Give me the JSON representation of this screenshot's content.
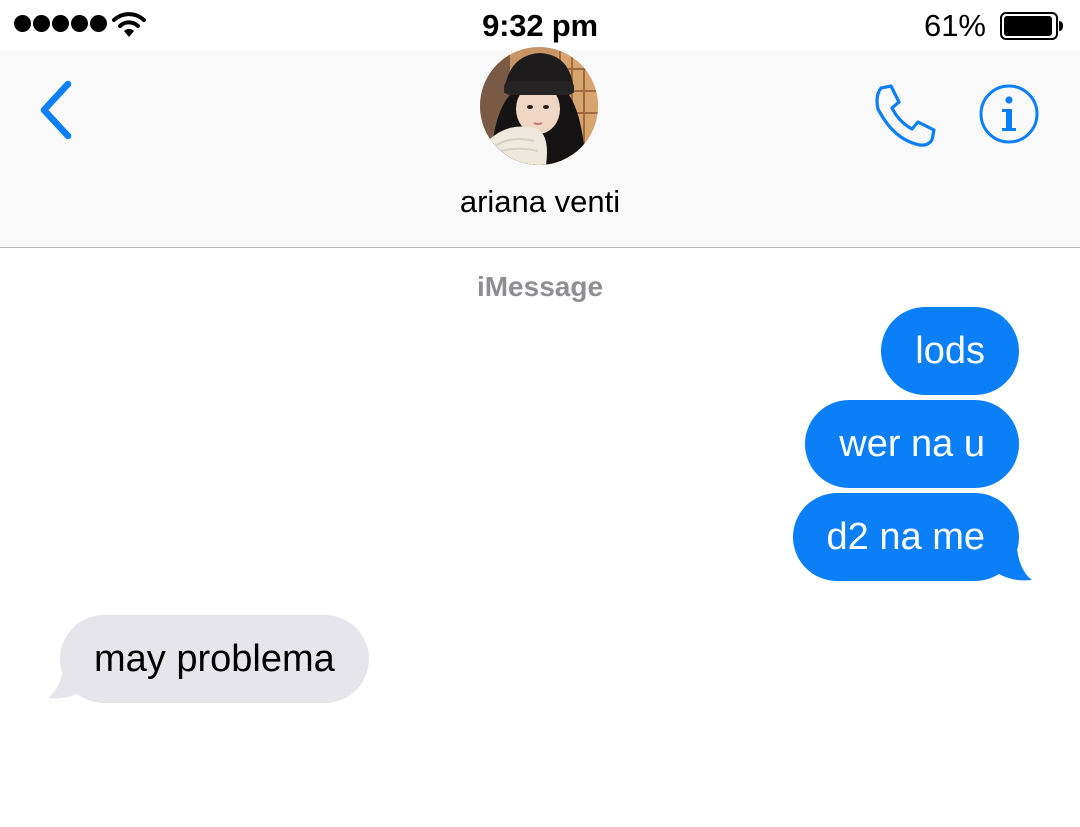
{
  "status_bar": {
    "time": "9:32 pm",
    "battery_percent": "61%",
    "battery_level": 0.61,
    "signal_bars": 5,
    "icons": [
      "signal-dots-icon",
      "wifi-icon",
      "battery-icon"
    ]
  },
  "header": {
    "contact_name": "ariana venti",
    "back_icon": "chevron-left-icon",
    "call_icon": "phone-icon",
    "info_icon": "info-icon",
    "avatar": "contact-avatar-photo"
  },
  "thread": {
    "service_label": "iMessage",
    "messages": [
      {
        "direction": "sent",
        "text": "lods"
      },
      {
        "direction": "sent",
        "text": "wer na u"
      },
      {
        "direction": "sent",
        "text": "d2 na me"
      },
      {
        "direction": "received",
        "text": "may problema"
      }
    ]
  },
  "colors": {
    "accent": "#0a7ff7",
    "sent_bubble": "#0a7ff7",
    "received_bubble": "#e6e5eb",
    "header_bg": "#f9f9f9",
    "secondary_text": "#8e8e93"
  }
}
